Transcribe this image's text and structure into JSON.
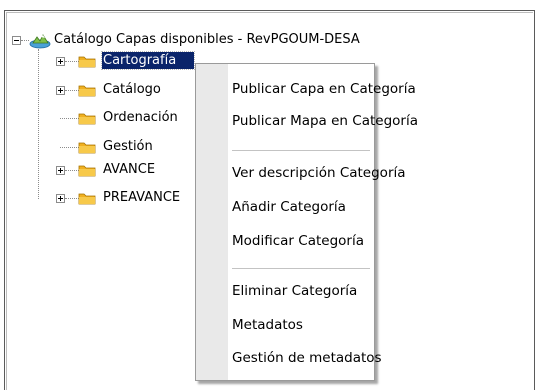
{
  "tree": {
    "root": {
      "label": "Catálogo Capas disponibles - RevPGOUM-DESA",
      "icon": "globe-icon",
      "expanded": true
    },
    "items": [
      {
        "label": "Cartografía",
        "icon": "folder-icon",
        "expandable": true,
        "selected": true
      },
      {
        "label": "Catálogo",
        "icon": "folder-icon",
        "expandable": true
      },
      {
        "label": "Ordenación",
        "icon": "folder-icon",
        "expandable": false
      },
      {
        "label": "Gestión",
        "icon": "folder-icon",
        "expandable": false
      },
      {
        "label": "AVANCE",
        "icon": "folder-icon",
        "expandable": true
      },
      {
        "label": "PREAVANCE",
        "icon": "folder-icon",
        "expandable": true
      }
    ]
  },
  "context_menu": {
    "items": [
      {
        "label": "Publicar Capa en Categoría"
      },
      {
        "label": "Publicar Mapa en Categoría"
      },
      {
        "label": "Ver descripción Categoría"
      },
      {
        "label": "Añadir Categoría"
      },
      {
        "label": "Modificar Categoría"
      },
      {
        "label": "Eliminar Categoría"
      },
      {
        "label": "Metadatos"
      },
      {
        "label": "Gestión de metadatos"
      }
    ]
  },
  "colors": {
    "selection": "#0a246a",
    "folder": "#f0b020",
    "menu_gutter": "#e9e9e9"
  }
}
